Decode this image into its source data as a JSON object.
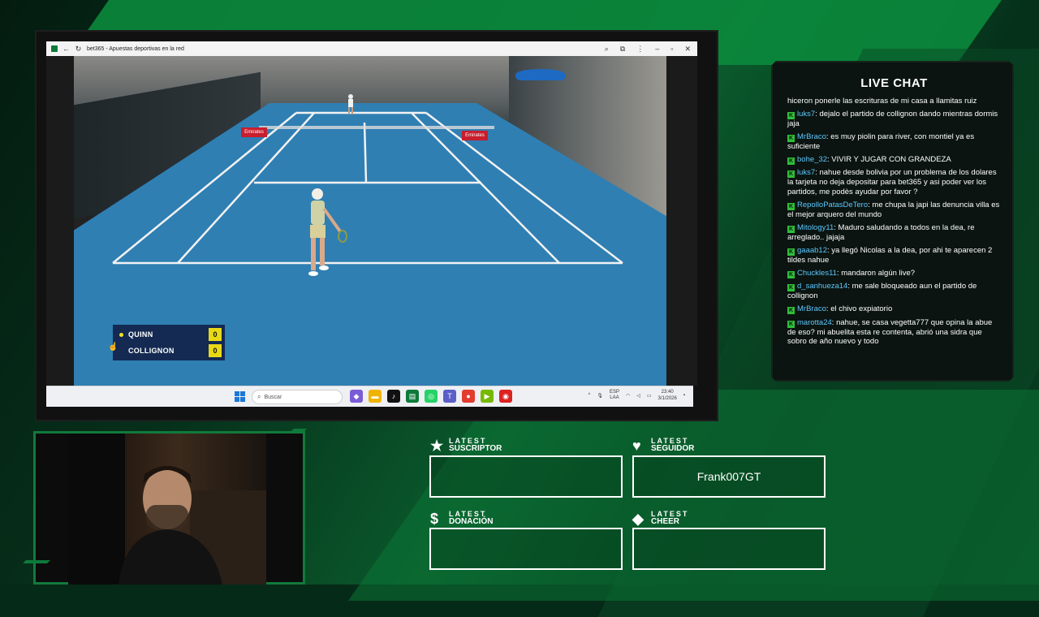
{
  "colors": {
    "accent": "#0d7a3a",
    "chat_username": "#5cc7ff",
    "scoreboard_bg": "#142a52",
    "score_yellow": "#e8d916"
  },
  "browser": {
    "title": "bet365 - Apuestas deportivas en la red",
    "icons": [
      "back-icon",
      "reload-icon",
      "zoom-icon",
      "extensions-icon",
      "menu-icon",
      "minimize-icon",
      "restore-icon",
      "close-icon"
    ]
  },
  "scoreboard": {
    "players": [
      {
        "name": "QUINN",
        "score": "0",
        "serving": true
      },
      {
        "name": "COLLIGNON",
        "score": "0",
        "serving": false
      }
    ]
  },
  "video": {
    "sign_left": "Emirates",
    "sign_right": "Emirates"
  },
  "taskbar": {
    "search_placeholder": "Buscar",
    "lang_top": "ESP",
    "lang_bottom": "LAA",
    "time": "23:40",
    "date": "3/1/2026"
  },
  "chat": {
    "title": "LIVE CHAT",
    "first_line": "hiceron ponerle las escrituras de mi casa a llamitas ruiz",
    "messages": [
      {
        "user": "luks7",
        "text": "dejalo el partido de collignon dando mientras dormis jaja"
      },
      {
        "user": "MrBraco",
        "text": "es muy piolin para river, con montiel ya es suficiente"
      },
      {
        "user": "bohe_32",
        "text": "VIVIR Y JUGAR CON GRANDEZA"
      },
      {
        "user": "luks7",
        "text": "nahue desde bolivia por un problema de los dolares la tarjeta no deja depositar para bet365 y asi poder ver los partidos, me podès ayudar por favor ?"
      },
      {
        "user": "RepolloPatasDeTero",
        "text": "me chupa la japi las denuncia villa es el mejor arquero del mundo"
      },
      {
        "user": "Mitology11",
        "text": "Maduro saludando a todos en la dea, re arreglado.. jajaja"
      },
      {
        "user": "gaaab12",
        "text": "ya llegó Nicolas a la dea, por ahi te aparecen 2 tildes nahue"
      },
      {
        "user": "Chuckles11",
        "text": "mandaron algún live?"
      },
      {
        "user": "d_sanhueza14",
        "text": "me sale bloqueado aun el partido de collignon"
      },
      {
        "user": "MrBraco",
        "text": "el chivo expiatorio"
      },
      {
        "user": "marotta24",
        "text": "nahue, se casa vegetta777 que opina la abue de eso? mi abuelita esta re contenta, abrió una sidra que sobro de año nuevo y todo"
      }
    ]
  },
  "latest": {
    "suscriptor": {
      "l1": "LATEST",
      "l2": "SUSCRIPTOR",
      "icon": "star-icon",
      "value": ""
    },
    "seguidor": {
      "l1": "LATEST",
      "l2": "SEGUIDOR",
      "icon": "heart-icon",
      "value": "Frank007GT"
    },
    "donacion": {
      "l1": "LATEST",
      "l2": "DONACIÓN",
      "icon": "dollar-icon",
      "value": ""
    },
    "cheer": {
      "l1": "LATEST",
      "l2": "CHEER",
      "icon": "diamond-icon",
      "value": ""
    }
  }
}
